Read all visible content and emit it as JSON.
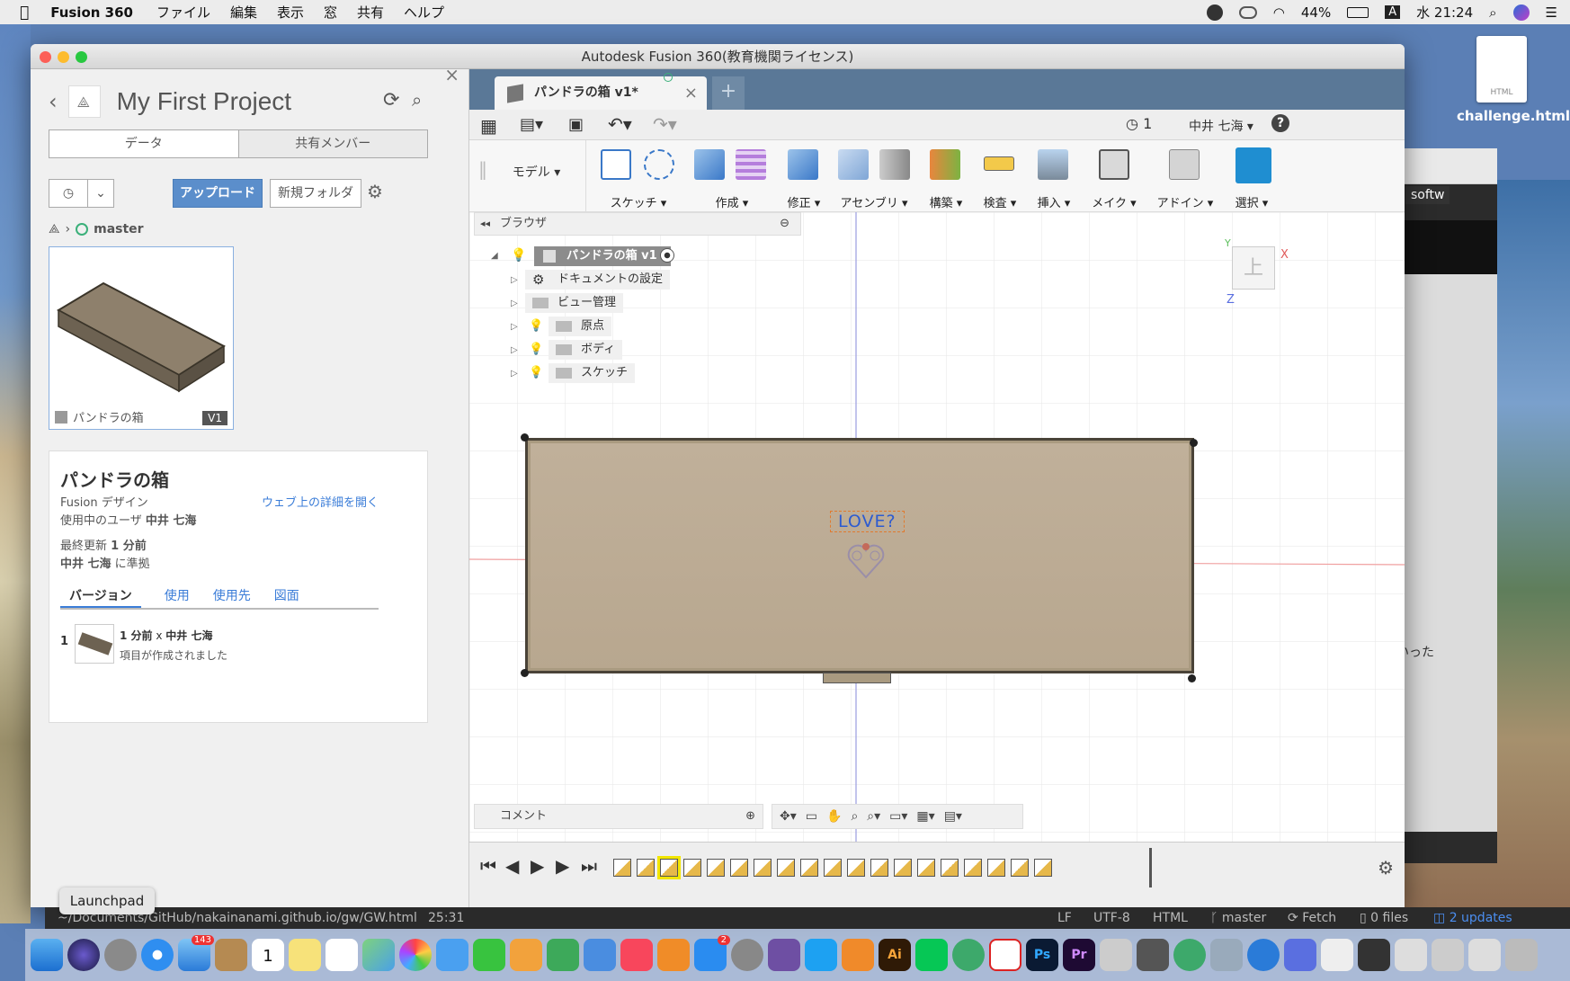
{
  "menubar": {
    "app_name": "Fusion 360",
    "menus": [
      "ファイル",
      "編集",
      "表示",
      "窓",
      "共有",
      "ヘルプ"
    ],
    "battery": "44%",
    "input_mode": "A",
    "clock": "水 21:24"
  },
  "desktop": {
    "file_label": "challenge.html",
    "file_badge": "HTML",
    "bg_window_text": "softw",
    "bg_window_text2": "いった"
  },
  "window": {
    "title": "Autodesk Fusion 360(教育機関ライセンス)"
  },
  "data_panel": {
    "project_title": "My First Project",
    "tab_data": "データ",
    "tab_members": "共有メンバー",
    "upload_label": "アップロード",
    "new_folder_label": "新規フォルダ",
    "branch": "master",
    "thumb_name": "パンドラの箱",
    "thumb_version": "V1",
    "detail": {
      "name": "パンドラの箱",
      "type": "Fusion デザイン",
      "open_web": "ウェブ上の詳細を開く",
      "user_label": "使用中のユーザ",
      "user_name": "中井 七海",
      "updated_label": "最終更新",
      "updated_value": "1 分前",
      "by_name": "中井 七海",
      "by_suffix": "に準拠",
      "tabs": [
        "バージョン",
        "使用",
        "使用先",
        "図面"
      ],
      "version_num": "1",
      "version_time": "1 分前",
      "version_x": "x",
      "version_user": "中井 七海",
      "version_note": "項目が作成されました"
    }
  },
  "workspace": {
    "doc_tab": "パンドラの箱 v1*",
    "job_count": "1",
    "user_menu": "中井 七海",
    "model_label": "モデル",
    "ribbon": [
      {
        "label": "スケッチ"
      },
      {
        "label": "作成"
      },
      {
        "label": "修正"
      },
      {
        "label": "アセンブリ"
      },
      {
        "label": "構築"
      },
      {
        "label": "検査"
      },
      {
        "label": "挿入"
      },
      {
        "label": "メイク"
      },
      {
        "label": "アドイン"
      },
      {
        "label": "選択"
      }
    ],
    "browser_label": "ブラウザ",
    "root_node": "パンドラの箱 v1",
    "tree": [
      "ドキュメントの設定",
      "ビュー管理",
      "原点",
      "ボディ",
      "スケッチ"
    ],
    "viewcube_face": "上",
    "axis_y": "Y",
    "axis_x": "X",
    "axis_z": "Z",
    "sketch_text": "LOVE?",
    "comment_label": "コメント"
  },
  "status_bar": {
    "path": "~/Documents/GitHub/nakainanami.github.io/gw/GW.html",
    "cursor": "25:31",
    "eol": "LF",
    "encoding": "UTF-8",
    "grammar": "HTML",
    "branch": "master",
    "fetch": "Fetch",
    "files": "0 files",
    "updates": "2 updates"
  },
  "tooltip": "Launchpad",
  "dock_badges": {
    "mail": "143",
    "appstore": "2",
    "calendar_day": "1"
  }
}
